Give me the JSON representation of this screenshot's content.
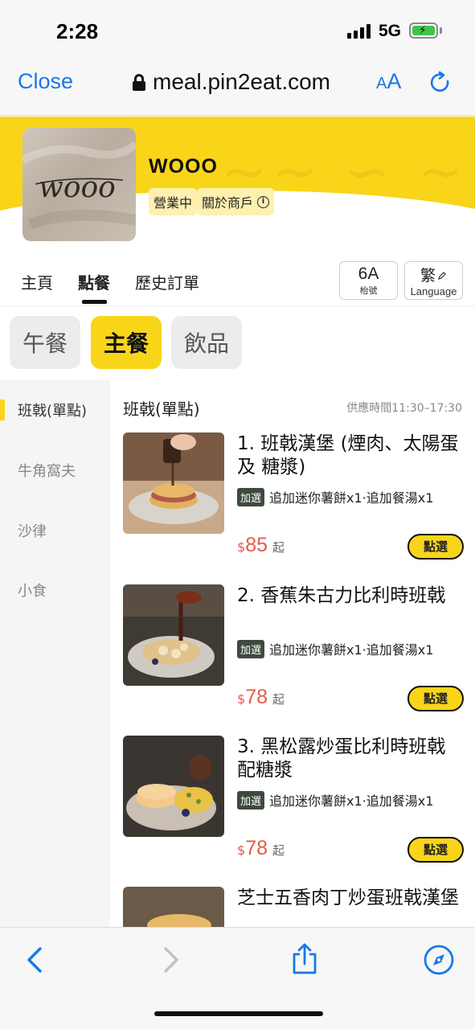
{
  "status_bar": {
    "time": "2:28",
    "network": "5G"
  },
  "browser": {
    "close_label": "Close",
    "url": "meal.pin2eat.com",
    "aa_small": "A",
    "aa_large": "A"
  },
  "shop": {
    "logo_text": "wooo",
    "name": "WOOO",
    "status_badge": "營業中",
    "about_badge": "關於商戶",
    "info_glyph": "i"
  },
  "nav": {
    "tabs": [
      {
        "label": "主頁"
      },
      {
        "label": "點餐"
      },
      {
        "label": "歷史訂單"
      }
    ],
    "seat": {
      "number": "6A",
      "label": "枱號"
    },
    "language": {
      "glyph": "繁",
      "label": "Language"
    }
  },
  "categories": [
    {
      "label": "午餐"
    },
    {
      "label": "主餐"
    },
    {
      "label": "飲品"
    }
  ],
  "side_menu": [
    {
      "label": "班戟(單點)"
    },
    {
      "label": "牛角窩夫"
    },
    {
      "label": "沙律"
    },
    {
      "label": "小食"
    }
  ],
  "section": {
    "title": "班戟(單點)",
    "hours": "供應時間11:30–17:30"
  },
  "items": [
    {
      "name": "1. 班戟漢堡 (煙肉、太陽蛋 及 糖漿)",
      "addon_tag": "加選",
      "addon_text": "追加迷你薯餅x1·追加餐湯x1",
      "currency": "$",
      "price": "85",
      "price_suffix": "起",
      "button": "點選"
    },
    {
      "name": "2. 香蕉朱古力比利時班戟",
      "addon_tag": "加選",
      "addon_text": "追加迷你薯餅x1·追加餐湯x1",
      "currency": "$",
      "price": "78",
      "price_suffix": "起",
      "button": "點選"
    },
    {
      "name": "3. 黑松露炒蛋比利時班戟配糖漿",
      "addon_tag": "加選",
      "addon_text": "追加迷你薯餅x1·追加餐湯x1",
      "currency": "$",
      "price": "78",
      "price_suffix": "起",
      "button": "點選"
    },
    {
      "name": "芝士五香肉丁炒蛋班戟漢堡"
    }
  ],
  "colors": {
    "brand_yellow": "#f9d51a",
    "ios_blue": "#1877e8",
    "price_red": "#e35b4b"
  },
  "icons": [
    "lock-icon",
    "reload-icon",
    "info-icon",
    "edit-icon",
    "back-icon",
    "forward-icon",
    "share-icon",
    "compass-icon"
  ]
}
